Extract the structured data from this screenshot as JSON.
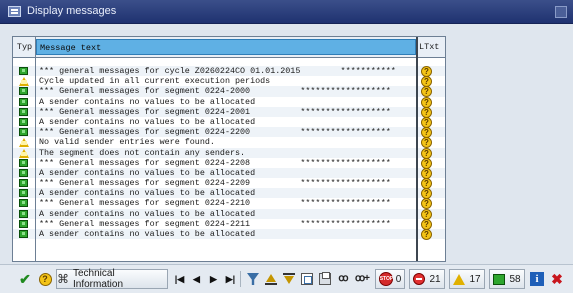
{
  "window": {
    "title": "Display messages"
  },
  "grid": {
    "columns": {
      "type": "Typ",
      "message": "Message text",
      "longtext": "LTxt"
    },
    "rows": [
      {
        "status": "success",
        "text": "*** general messages for cycle Z0260224CO 01.01.2015        ***********"
      },
      {
        "status": "warning",
        "text": "Cycle updated in all current execution periods"
      },
      {
        "status": "success",
        "text": "*** General messages for segment 0224-2000          ******************"
      },
      {
        "status": "success",
        "text": "A sender contains no values to be allocated"
      },
      {
        "status": "success",
        "text": "*** General messages for segment 0224-2001          ******************"
      },
      {
        "status": "success",
        "text": "A sender contains no values to be allocated"
      },
      {
        "status": "success",
        "text": "*** General messages for segment 0224-2200          ******************"
      },
      {
        "status": "warning",
        "text": "No valid sender entries were found."
      },
      {
        "status": "warning",
        "text": "The segment does not contain any senders."
      },
      {
        "status": "success",
        "text": "*** General messages for segment 0224-2208          ******************"
      },
      {
        "status": "success",
        "text": "A sender contains no values to be allocated"
      },
      {
        "status": "success",
        "text": "*** General messages for segment 0224-2209          ******************"
      },
      {
        "status": "success",
        "text": "A sender contains no values to be allocated"
      },
      {
        "status": "success",
        "text": "*** General messages for segment 0224-2210          ******************"
      },
      {
        "status": "success",
        "text": "A sender contains no values to be allocated"
      },
      {
        "status": "success",
        "text": "*** General messages for segment 0224-2211          ******************"
      },
      {
        "status": "success",
        "text": "A sender contains no values to be allocated"
      }
    ]
  },
  "toolbar": {
    "technical_info_label": "Technical Information",
    "stop_count": "0",
    "error_count": "21",
    "warning_count": "17",
    "success_count": "58"
  },
  "colors": {
    "title_bar": "#1f3270",
    "header_highlight": "#5fb0e4",
    "success": "#2ea62e",
    "warning": "#e0b000",
    "error": "#e23030"
  }
}
